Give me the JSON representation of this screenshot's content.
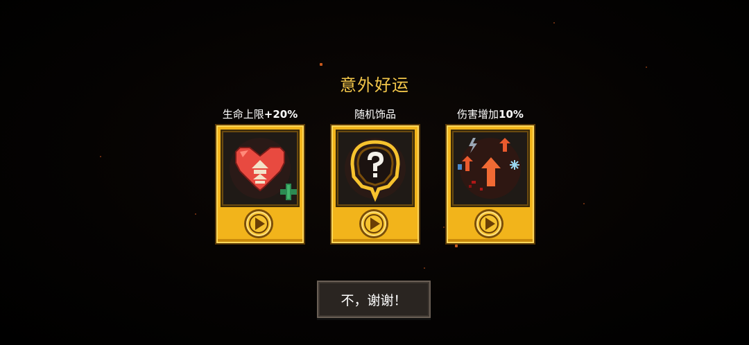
{
  "title": "意外好运",
  "cards": [
    {
      "label_text": "生命上限",
      "label_value": "+20%",
      "icon": "heart-health-up-icon",
      "action": "play-icon"
    },
    {
      "label_text": "随机饰品",
      "label_value": "",
      "icon": "mystery-accessory-icon",
      "action": "play-icon"
    },
    {
      "label_text": "伤害增加",
      "label_value": "10%",
      "icon": "damage-up-arrows-icon",
      "action": "play-icon"
    }
  ],
  "decline_button": "不，谢谢！",
  "colors": {
    "title": "#f2c64a",
    "card_gold": "#f2b41b",
    "button_bg": "#2a2521"
  }
}
